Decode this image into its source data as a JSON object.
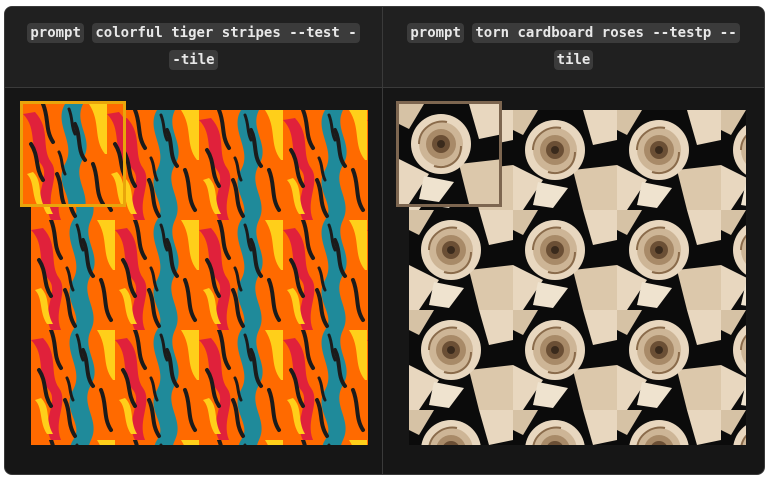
{
  "panels": [
    {
      "prompt_tokens": [
        "prompt",
        "colorful tiger stripes --test -",
        "-tile"
      ],
      "image_label": "colorful tiger stripes pattern",
      "colors": [
        "#ff6a00",
        "#1f8a9a",
        "#e0213b",
        "#ffcf1a",
        "#1b1b1b"
      ]
    },
    {
      "prompt_tokens": [
        "prompt",
        "torn cardboard roses --testp --",
        "tile"
      ],
      "image_label": "torn cardboard roses pattern",
      "colors": [
        "#e8d7bf",
        "#8a6b4b",
        "#3a2a1c",
        "#0b0b0b"
      ]
    }
  ]
}
